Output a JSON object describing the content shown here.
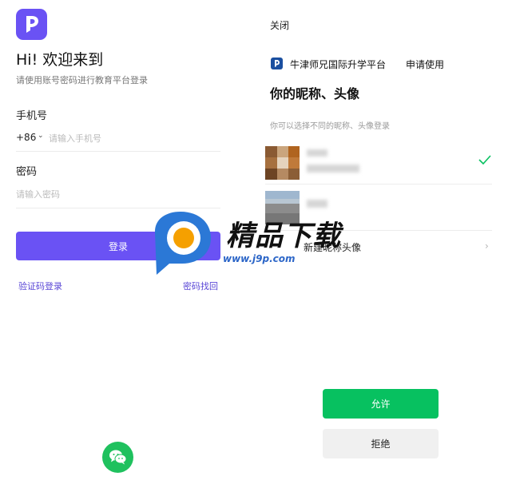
{
  "login": {
    "welcome": "Hi! 欢迎来到",
    "subtitle": "请使用账号密码进行教育平台登录",
    "phone_label": "手机号",
    "country_code": "+86",
    "phone_placeholder": "请输入手机号",
    "password_label": "密码",
    "password_placeholder": "请输入密码",
    "login_button": "登录",
    "sms_login": "验证码登录",
    "recover_password": "密码找回"
  },
  "auth": {
    "close": "关闭",
    "platform_name": "牛津师兄国际升学平台",
    "request_use": "申请使用",
    "title": "你的昵称、头像",
    "hint": "你可以选择不同的昵称、头像登录",
    "new_avatar": "新建昵称头像",
    "allow": "允许",
    "deny": "拒绝",
    "selected_index": 0
  },
  "watermark": {
    "text": "精品下载",
    "url": "www.j9p.com"
  },
  "colors": {
    "brand": "#6a52f4",
    "wechat_green": "#07c160",
    "check_green": "#07c160",
    "link": "#5a47d6",
    "platform_blue": "#1a4fa0"
  },
  "icons": [
    "app-logo-icon",
    "chevron-down-icon",
    "wechat-icon",
    "platform-logo-icon",
    "check-icon",
    "chevron-right-icon"
  ]
}
